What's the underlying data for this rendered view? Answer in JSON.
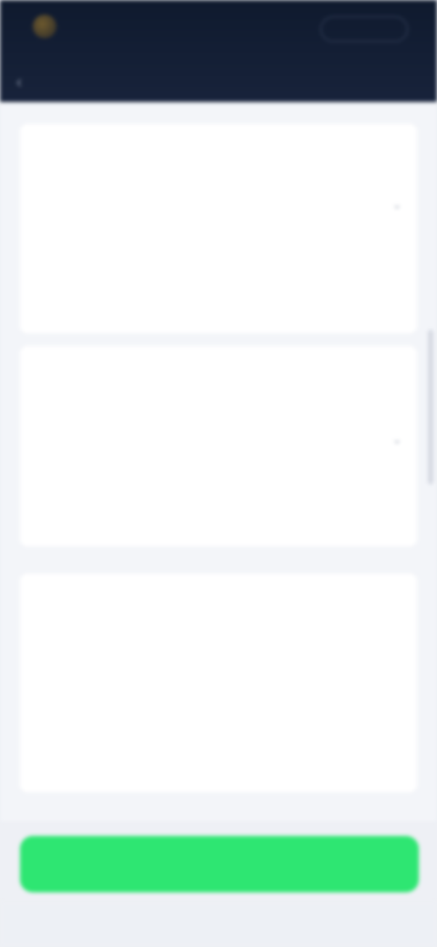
{
  "header": {
    "logo_text": "",
    "login_label": "",
    "page_title": "",
    "back_icon": "chevron-left-icon"
  },
  "faq": [
    {
      "number": "",
      "question": "",
      "answer": ""
    },
    {
      "number": "",
      "question": "",
      "answer": ""
    }
  ],
  "section": {
    "title": "",
    "sub_label": "",
    "question": "",
    "answer": ""
  },
  "cta": {
    "label": "",
    "color": "#2ee672"
  },
  "colors": {
    "header_bg": "#0f1a2e",
    "page_bg": "#f3f5f9",
    "accent": "#2ee672"
  }
}
